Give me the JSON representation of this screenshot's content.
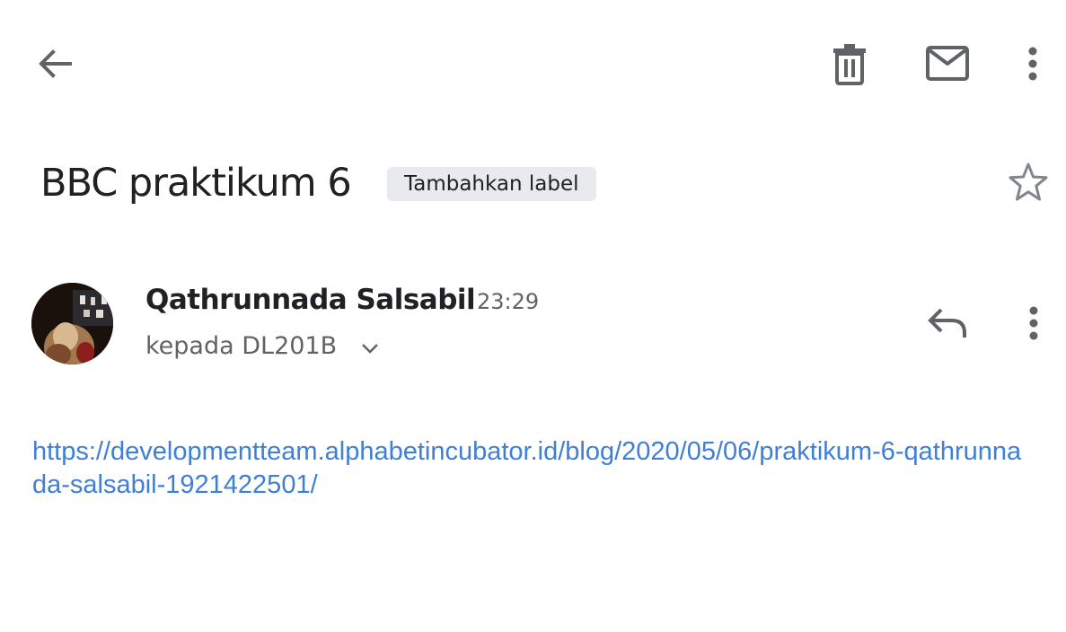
{
  "toolbar": {
    "back_icon": "arrow-back-icon",
    "delete_icon": "trash-icon",
    "mark_unread_icon": "mail-icon",
    "more_icon": "more-vert-icon"
  },
  "email": {
    "subject": "BBC praktikum 6",
    "label_chip": "Tambahkan label",
    "star_icon": "star-outline-icon",
    "sender_name": "Qathrunnada Salsabil",
    "time": "23:29",
    "recipient": "kepada DL201B",
    "body_link": "https://developmentteam.alphabetincubator.id/blog/2020/05/06/praktikum-6-qathrunnada-salsabil-1921422501/"
  },
  "colors": {
    "link": "#3f7fd6",
    "icon": "#5f6368",
    "chip_bg": "#e8eaed",
    "text": "#202124"
  }
}
